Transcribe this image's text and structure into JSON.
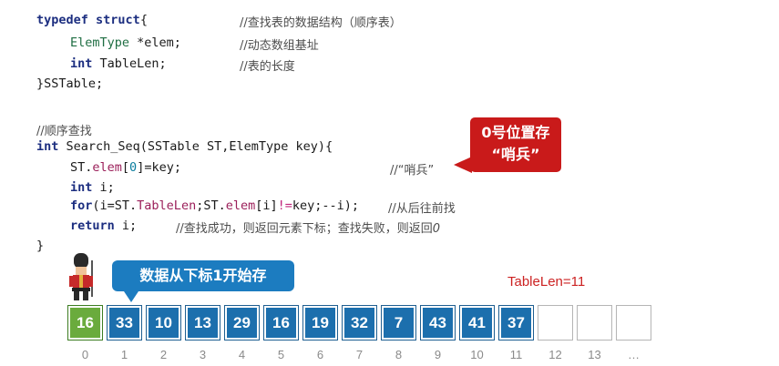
{
  "struct_code": {
    "line1": {
      "kw1": "typedef",
      "kw2": "struct",
      "brace": "{",
      "comment": "//查找表的数据结构（顺序表）"
    },
    "line2": {
      "type": "ElemType",
      "rest": " *elem;",
      "comment": "//动态数组基址"
    },
    "line3": {
      "type": "int",
      "rest": " TableLen;",
      "comment": "//表的长度"
    },
    "line4": {
      "text": "}SSTable;"
    }
  },
  "search_code": {
    "comment_title": "//顺序查找",
    "sig": {
      "kw": "int",
      "rest": " Search_Seq(SSTable ST,ElemType key){"
    },
    "assign": {
      "pre": "ST.",
      "mem": "elem",
      "lb": "[",
      "num": "0",
      "rest": "]=key;",
      "comment": "//“哨兵”"
    },
    "decl": {
      "kw": "int",
      "rest": " i;"
    },
    "loop": {
      "kw": "for",
      "p1": "(i=ST.",
      "mem1": "TableLen",
      "p2": ";ST.",
      "mem2": "elem",
      "p3": "[i]",
      "op": "!=",
      "p4": "key;--i);",
      "comment": "//从后往前找"
    },
    "ret": {
      "kw": "return",
      "rest": " i;",
      "comment": "//查找成功，则返回元素下标；查找失败，则返回",
      "zero": "0"
    },
    "close": "}"
  },
  "callouts": {
    "red": {
      "line1": "0号位置存",
      "line2": "“哨兵”"
    },
    "blue": "数据从下标1开始存"
  },
  "table_len_label": "TableLen=11",
  "array": {
    "values": [
      "16",
      "33",
      "10",
      "13",
      "29",
      "16",
      "19",
      "32",
      "7",
      "43",
      "41",
      "37",
      "",
      "",
      ""
    ],
    "indices": [
      "0",
      "1",
      "2",
      "3",
      "4",
      "5",
      "6",
      "7",
      "8",
      "9",
      "10",
      "11",
      "12",
      "13",
      "…"
    ]
  },
  "colors": {
    "sentinel": "#6aab3d",
    "filled": "#1c6fad",
    "callout_red": "#c91a1a",
    "callout_blue": "#1c7cc0",
    "table_len": "#cc2222"
  }
}
